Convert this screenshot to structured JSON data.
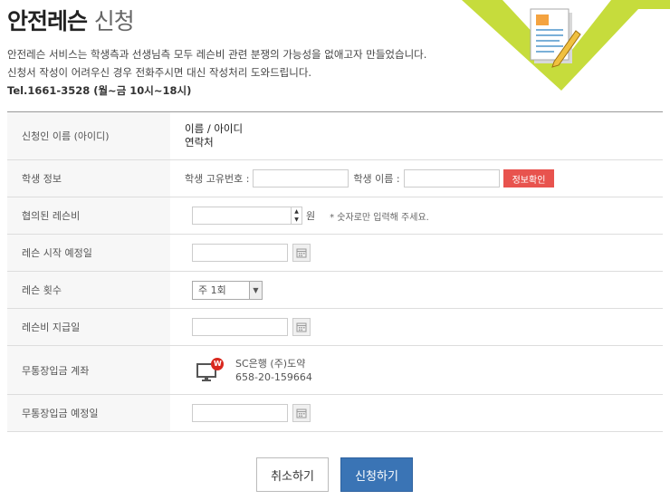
{
  "header": {
    "title_main": "안전레슨",
    "title_sub": "신청",
    "intro_line1": "안전레슨 서비스는 학생측과 선생님측 모두 레슨비 관련 분쟁의 가능성을 없애고자 만들었습니다.",
    "intro_line2": "신청서 작성이 어려우신 경우 전화주시면 대신 작성처리 도와드립니다.",
    "tel": "Tel.1661-3528 (월~금 10시~18시)"
  },
  "form": {
    "applicant": {
      "label": "신청인 이름 (아이디)",
      "line1": "이름 / 아이디",
      "line2": "연락처"
    },
    "student": {
      "label": "학생 정보",
      "id_label": "학생 고유번호 :",
      "id_value": "",
      "name_label": "학생 이름 :",
      "name_value": "",
      "check_button": "정보확인"
    },
    "fee": {
      "label": "협의된 레슨비",
      "value": "",
      "unit": "원",
      "note": "* 숫자로만 입력해 주세요."
    },
    "start_date": {
      "label": "레슨 시작 예정일",
      "value": ""
    },
    "count": {
      "label": "레슨 횟수",
      "selected": "주 1회"
    },
    "pay_date": {
      "label": "레슨비 지급일",
      "value": ""
    },
    "account": {
      "label": "무통장입금 계좌",
      "bank": "SC은행 (주)도약",
      "number": "658-20-159664",
      "badge": "W"
    },
    "deposit_date": {
      "label": "무통장입금 예정일",
      "value": ""
    }
  },
  "actions": {
    "cancel": "취소하기",
    "submit": "신청하기"
  },
  "colors": {
    "accent_green": "#c6dc3c",
    "check_red": "#e8534e",
    "submit_blue": "#3a74b5"
  },
  "icons": {
    "document": "document-pencil-icon",
    "calendar": "calendar-icon",
    "monitor": "monitor-icon"
  }
}
